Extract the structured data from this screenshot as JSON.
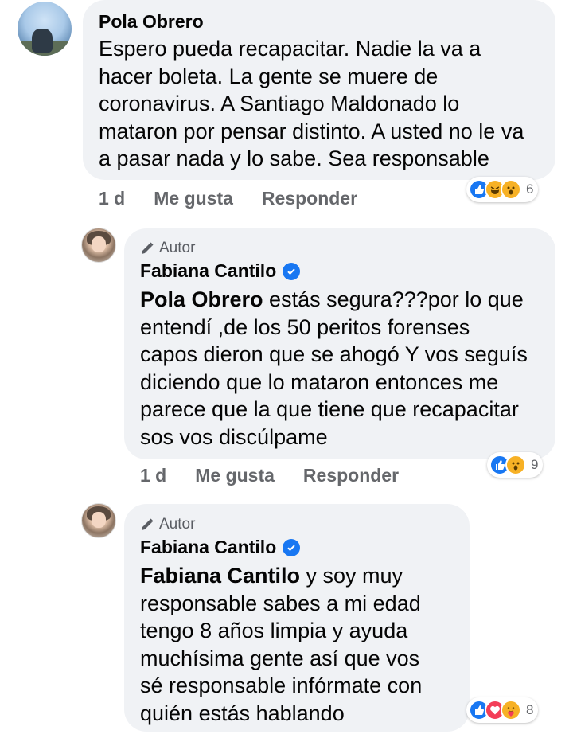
{
  "comments": [
    {
      "author": "Pola Obrero",
      "text": "Espero pueda recapacitar. Nadie la va a\nhacer boleta. La gente se muere de\ncoronavirus. A Santiago Maldonado lo\nmataron por pensar distinto. A usted no le va\na pasar nada y lo sabe. Sea responsable",
      "time": "1 d",
      "like_label": "Me gusta",
      "reply_label": "Responder",
      "reactions": [
        "like",
        "haha",
        "wow"
      ],
      "reaction_count": "6"
    },
    {
      "badge": "Autor",
      "author": "Fabiana Cantilo",
      "mention": "Pola Obrero",
      "text": " estás segura???por lo que\nentendí ,de los 50 peritos forenses\ncapos dieron que se ahogó Y vos seguís\ndiciendo que lo mataron entonces me\nparece que la que tiene que recapacitar\nsos vos discúlpame",
      "time": "1 d",
      "like_label": "Me gusta",
      "reply_label": "Responder",
      "reactions": [
        "like",
        "wow"
      ],
      "reaction_count": "9"
    },
    {
      "badge": "Autor",
      "author": "Fabiana Cantilo",
      "mention": "Fabiana Cantilo",
      "text": " y soy muy\nresponsable sabes a mi edad\ntengo 8 años limpia y ayuda\nmuchísima gente así que vos\nsé responsable infórmate con\nquién estás hablando",
      "reactions": [
        "like",
        "love",
        "care"
      ],
      "reaction_count": "8"
    }
  ],
  "colors": {
    "bubble": "#f0f2f5",
    "like": "#1877f2",
    "love": "#f33e58",
    "emoji": "#f7b125",
    "secondary_text": "#65676b"
  }
}
